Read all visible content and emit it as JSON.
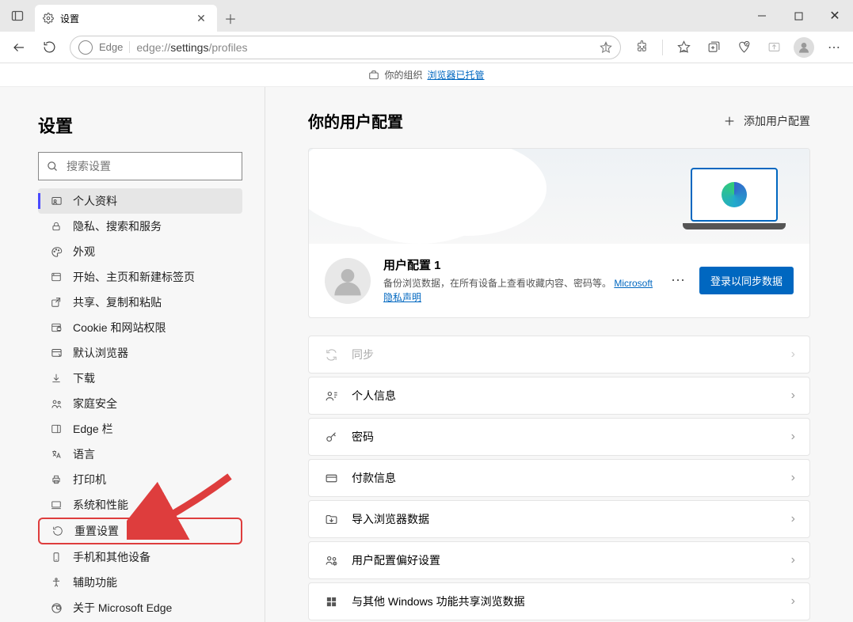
{
  "titlebar": {
    "tab_title": "设置",
    "url_prefix": "Edge",
    "url_gray_pre": "edge://",
    "url_main": "settings",
    "url_gray_post": "/profiles"
  },
  "managed": {
    "prefix": "你的组织",
    "link": "浏览器已托管"
  },
  "sidebar": {
    "title": "设置",
    "search_placeholder": "搜索设置",
    "items": [
      {
        "label": "个人资料"
      },
      {
        "label": "隐私、搜索和服务"
      },
      {
        "label": "外观"
      },
      {
        "label": "开始、主页和新建标签页"
      },
      {
        "label": "共享、复制和粘贴"
      },
      {
        "label": "Cookie 和网站权限"
      },
      {
        "label": "默认浏览器"
      },
      {
        "label": "下载"
      },
      {
        "label": "家庭安全"
      },
      {
        "label": "Edge 栏"
      },
      {
        "label": "语言"
      },
      {
        "label": "打印机"
      },
      {
        "label": "系统和性能"
      },
      {
        "label": "重置设置"
      },
      {
        "label": "手机和其他设备"
      },
      {
        "label": "辅助功能"
      },
      {
        "label": "关于 Microsoft Edge"
      }
    ]
  },
  "content": {
    "heading": "你的用户配置",
    "add_profile": "添加用户配置",
    "profile": {
      "name": "用户配置 1",
      "desc_pre": "备份浏览数据，在所有设备上查看收藏内容、密码等。 ",
      "privacy_link": "Microsoft 隐私声明",
      "signin": "登录以同步数据"
    },
    "rows": [
      {
        "label": "同步",
        "disabled": true
      },
      {
        "label": "个人信息"
      },
      {
        "label": "密码"
      },
      {
        "label": "付款信息"
      },
      {
        "label": "导入浏览器数据"
      },
      {
        "label": "用户配置偏好设置"
      },
      {
        "label": "与其他 Windows 功能共享浏览数据"
      }
    ]
  }
}
